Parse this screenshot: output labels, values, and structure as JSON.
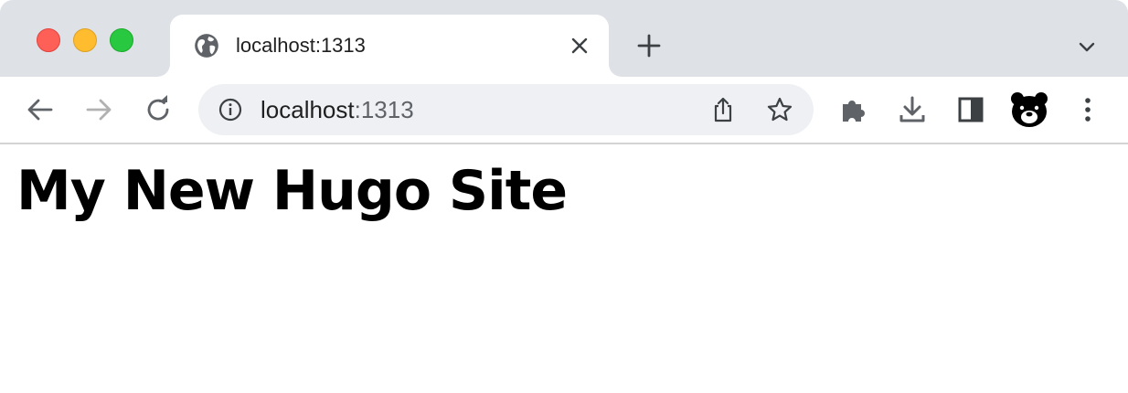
{
  "tab": {
    "title": "localhost:1313"
  },
  "address_bar": {
    "host": "localhost",
    "port": ":1313"
  },
  "page": {
    "heading": "My New Hugo Site"
  },
  "icons": {
    "favicon": "globe-icon",
    "tab_close": "close-icon",
    "new_tab": "plus-icon",
    "tab_search": "chevron-down-icon",
    "back": "arrow-left-icon",
    "forward": "arrow-right-icon",
    "reload": "reload-icon",
    "site_info": "info-icon",
    "share": "share-icon",
    "bookmark": "star-icon",
    "extensions": "puzzle-icon",
    "downloads": "download-icon",
    "side_panel": "side-panel-icon",
    "profile": "bear-avatar-icon",
    "menu": "kebab-menu-icon"
  },
  "colors": {
    "tabstrip_bg": "#dee1e6",
    "omnibox_bg": "#eef0f3",
    "close_light": "#fe5f57",
    "minimize_light": "#febc2e",
    "maximize_light": "#28c840",
    "icon_color": "#5f6368",
    "disabled_icon": "#b1b1b1"
  }
}
